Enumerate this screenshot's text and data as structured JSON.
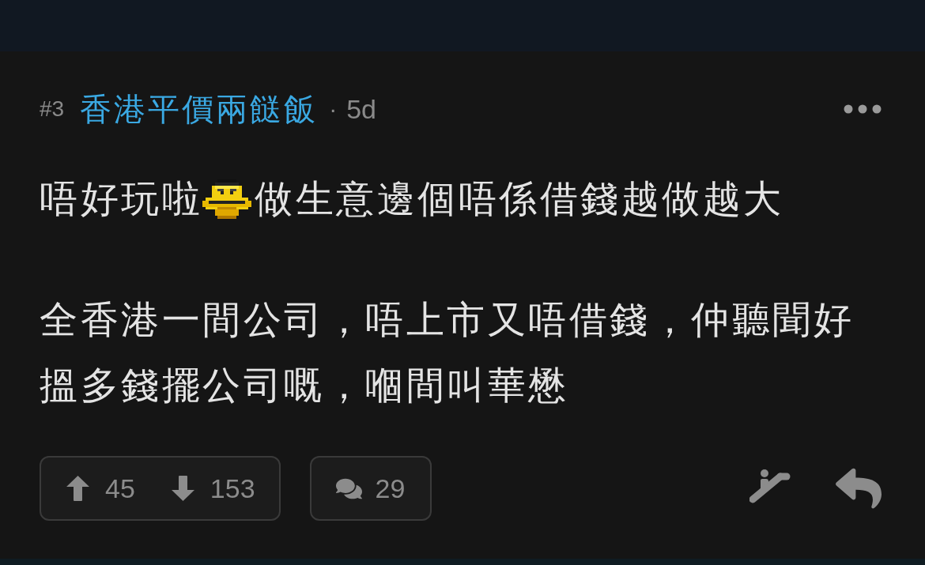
{
  "post": {
    "number": "#3",
    "author": "香港平價兩餸飯",
    "separator": "·",
    "age": "5d",
    "body": [
      {
        "parts": [
          {
            "kind": "text",
            "text": "唔好玩啦"
          },
          {
            "kind": "emoji"
          },
          {
            "kind": "text",
            "text": "做生意邊個唔係借錢越做越大"
          }
        ]
      },
      {
        "parts": [
          {
            "kind": "text",
            "text": "全香港一間公司，唔上市又唔借錢，仲聽聞好搵多錢擺公司嘅，嗰間叫華懋"
          }
        ]
      }
    ]
  },
  "actions": {
    "upvotes": "45",
    "downvotes": "153",
    "replies": "29"
  }
}
